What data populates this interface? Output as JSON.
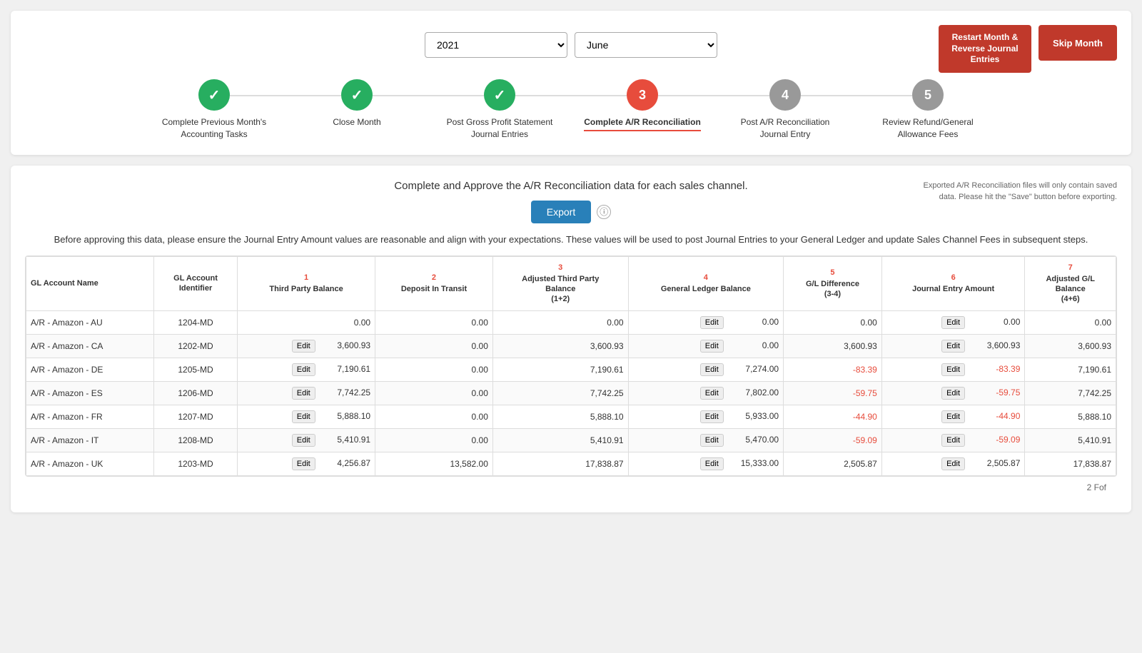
{
  "header": {
    "restart_btn": "Restart Month &\nReverse Journal\nEntries",
    "skip_btn": "Skip Month",
    "year_value": "2021",
    "month_value": "June"
  },
  "steps": [
    {
      "id": 1,
      "status": "complete",
      "label": "Complete Previous Month's\nAccounting Tasks",
      "num": "✓"
    },
    {
      "id": 2,
      "status": "complete",
      "label": "Close Month",
      "num": "✓"
    },
    {
      "id": 3,
      "status": "complete",
      "label": "Post Gross Profit Statement\nJournal Entries",
      "num": "✓"
    },
    {
      "id": 4,
      "status": "active",
      "label": "Complete A/R Reconciliation",
      "num": "3"
    },
    {
      "id": 5,
      "status": "inactive",
      "label": "Post A/R Reconciliation\nJournal Entry",
      "num": "4"
    },
    {
      "id": 6,
      "status": "inactive",
      "label": "Review Refund/General\nAllowance Fees",
      "num": "5"
    }
  ],
  "content": {
    "header_text": "Complete and Approve the A/R Reconciliation data for each sales channel.",
    "export_btn": "Export",
    "export_note": "Exported A/R Reconciliation files will only contain saved data. Please hit the \"Save\" button before exporting.",
    "warning_text": "Before approving this data, please ensure the Journal Entry Amount values are reasonable and align with your expectations. These values will be used to post Journal Entries to your General Ledger and update Sales Channel Fees in subsequent steps."
  },
  "table": {
    "columns": [
      {
        "num": "",
        "label": "GL Account Name",
        "sub": ""
      },
      {
        "num": "",
        "label": "GL Account\nIdentifier",
        "sub": ""
      },
      {
        "num": "1",
        "label": "Third Party Balance",
        "sub": ""
      },
      {
        "num": "2",
        "label": "Deposit In Transit",
        "sub": ""
      },
      {
        "num": "3",
        "label": "Adjusted Third Party\nBalance\n(1+2)",
        "sub": ""
      },
      {
        "num": "4",
        "label": "General Ledger Balance",
        "sub": ""
      },
      {
        "num": "5",
        "label": "G/L Difference\n(3-4)",
        "sub": ""
      },
      {
        "num": "6",
        "label": "Journal Entry Amount",
        "sub": ""
      },
      {
        "num": "7",
        "label": "Adjusted G/L\nBalance\n(4+6)",
        "sub": ""
      }
    ],
    "rows": [
      {
        "account_name": "A/R - Amazon - AU",
        "identifier": "1204-MD",
        "tp_balance": "0.00",
        "tp_has_edit": false,
        "deposit": "0.00",
        "deposit_has_edit": false,
        "adj_tp": "0.00",
        "gl_balance": "0.00",
        "gl_has_edit": true,
        "gl_diff": "0.00",
        "je_amount": "0.00",
        "je_has_edit": true,
        "adj_gl": "0.00"
      },
      {
        "account_name": "A/R - Amazon - CA",
        "identifier": "1202-MD",
        "tp_balance": "3,600.93",
        "tp_has_edit": true,
        "deposit": "0.00",
        "deposit_has_edit": false,
        "adj_tp": "3,600.93",
        "gl_balance": "0.00",
        "gl_has_edit": true,
        "gl_diff": "3,600.93",
        "je_amount": "3,600.93",
        "je_has_edit": true,
        "adj_gl": "3,600.93"
      },
      {
        "account_name": "A/R - Amazon - DE",
        "identifier": "1205-MD",
        "tp_balance": "7,190.61",
        "tp_has_edit": true,
        "deposit": "0.00",
        "deposit_has_edit": false,
        "adj_tp": "7,190.61",
        "gl_balance": "7,274.00",
        "gl_has_edit": true,
        "gl_diff": "-83.39",
        "je_amount": "-83.39",
        "je_has_edit": true,
        "adj_gl": "7,190.61"
      },
      {
        "account_name": "A/R - Amazon - ES",
        "identifier": "1206-MD",
        "tp_balance": "7,742.25",
        "tp_has_edit": true,
        "deposit": "0.00",
        "deposit_has_edit": false,
        "adj_tp": "7,742.25",
        "gl_balance": "7,802.00",
        "gl_has_edit": true,
        "gl_diff": "-59.75",
        "je_amount": "-59.75",
        "je_has_edit": true,
        "adj_gl": "7,742.25"
      },
      {
        "account_name": "A/R - Amazon - FR",
        "identifier": "1207-MD",
        "tp_balance": "5,888.10",
        "tp_has_edit": true,
        "deposit": "0.00",
        "deposit_has_edit": false,
        "adj_tp": "5,888.10",
        "gl_balance": "5,933.00",
        "gl_has_edit": true,
        "gl_diff": "-44.90",
        "je_amount": "-44.90",
        "je_has_edit": true,
        "adj_gl": "5,888.10"
      },
      {
        "account_name": "A/R - Amazon - IT",
        "identifier": "1208-MD",
        "tp_balance": "5,410.91",
        "tp_has_edit": true,
        "deposit": "0.00",
        "deposit_has_edit": false,
        "adj_tp": "5,410.91",
        "gl_balance": "5,470.00",
        "gl_has_edit": true,
        "gl_diff": "-59.09",
        "je_amount": "-59.09",
        "je_has_edit": true,
        "adj_gl": "5,410.91"
      },
      {
        "account_name": "A/R - Amazon - UK",
        "identifier": "1203-MD",
        "tp_balance": "4,256.87",
        "tp_has_edit": true,
        "deposit": "13,582.00",
        "deposit_has_edit": false,
        "adj_tp": "17,838.87",
        "gl_balance": "15,333.00",
        "gl_has_edit": true,
        "gl_diff": "2,505.87",
        "je_amount": "2,505.87",
        "je_has_edit": true,
        "adj_gl": "17,838.87"
      }
    ]
  },
  "pagination": {
    "text": "2 Fof"
  }
}
